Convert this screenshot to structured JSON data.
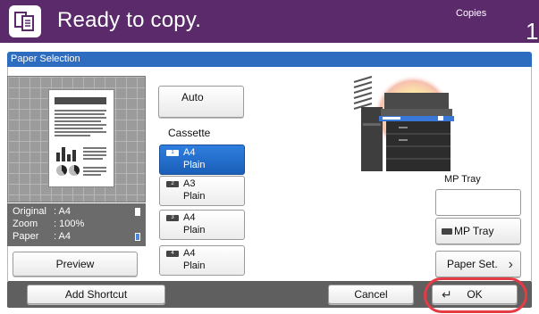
{
  "header": {
    "title": "Ready to copy.",
    "copies_label": "Copies",
    "copies_count": "1",
    "background": "#5a2a6a"
  },
  "window": {
    "title": "Paper Selection",
    "bar_color": "#2e6cc0"
  },
  "preview": {
    "info": [
      {
        "key": "Original",
        "value": ": A4"
      },
      {
        "key": "Zoom",
        "value": ": 100%"
      },
      {
        "key": "Paper",
        "value": ": A4"
      }
    ],
    "button_label": "Preview"
  },
  "paper": {
    "auto_label": "Auto",
    "cassette_label": "Cassette",
    "cassettes": [
      {
        "line1": "A4",
        "line2": "Plain",
        "selected": true
      },
      {
        "line1": "A3",
        "line2": "Plain",
        "selected": false
      },
      {
        "line1": "A4",
        "line2": "Plain",
        "selected": false
      },
      {
        "line1": "A4",
        "line2": "Plain",
        "selected": false
      }
    ],
    "accent": "#2f7fe0"
  },
  "mp_tray": {
    "label": "MP Tray",
    "button_label": "MP Tray",
    "paper_set_label": "Paper Set."
  },
  "bottom": {
    "add_shortcut": "Add Shortcut",
    "cancel": "Cancel",
    "ok": "OK",
    "highlight_color": "#e63a45"
  }
}
